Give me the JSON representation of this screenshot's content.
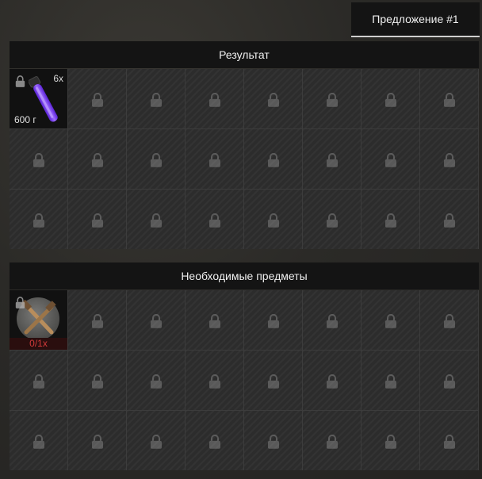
{
  "offer_tab": {
    "label": "Предложение #1"
  },
  "result": {
    "title": "Результат",
    "item": {
      "icon": "purple-glowstick-icon",
      "quantity": "6x",
      "weight": "600 г"
    }
  },
  "required": {
    "title": "Необходимые предметы",
    "item": {
      "icon": "crossed-tools-icon",
      "count": "0/1x"
    }
  },
  "colors": {
    "accent_need": "#d23a3a",
    "glow": "#7b3cff"
  }
}
